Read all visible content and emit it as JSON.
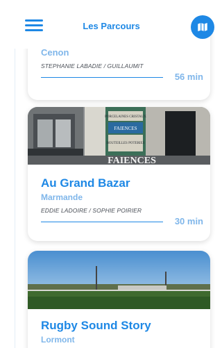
{
  "header": {
    "title": "Les Parcours",
    "menu_icon": "hamburger-icon",
    "map_icon": "map-icon",
    "accent": "#1e88e5"
  },
  "parcours": [
    {
      "title": "",
      "city": "Cenon",
      "authors": "STEPHANIE LABADIE / GUILLAUMIT",
      "duration": "56 min"
    },
    {
      "title": "Au Grand Bazar",
      "city": "Marmande",
      "authors": "EDDIE LADOIRE / SOPHIE POIRIER",
      "duration": "30 min",
      "photo_text": {
        "sign_top": "PORCELAINES CRISTAUX",
        "sign_mid": "FAIENCES",
        "sign_bottom": "BOUTEILLES POTERIES",
        "banner": "FAIENCES"
      }
    },
    {
      "title": "Rugby Sound Story",
      "city": "Lormont"
    }
  ]
}
